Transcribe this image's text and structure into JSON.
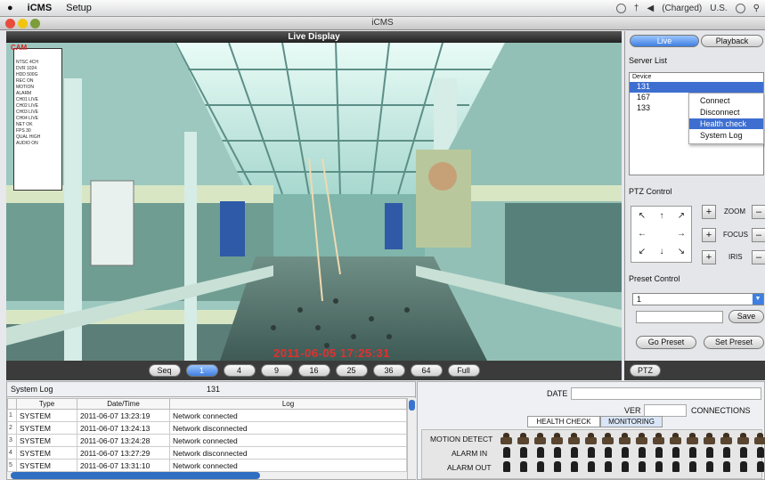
{
  "menubar": {
    "apple": "",
    "app": "iCMS",
    "setup": "Setup",
    "battery": "(Charged)",
    "lang": "U.S."
  },
  "window": {
    "title": "iCMS"
  },
  "video": {
    "header": "Live Display",
    "timestamp": "2011-06-05 17:25:31",
    "osd_logo": "CAM"
  },
  "modes": [
    "Seq",
    "1",
    "4",
    "9",
    "16",
    "25",
    "36",
    "64",
    "Full"
  ],
  "active_mode": "1",
  "right": {
    "tab_live": "Live",
    "tab_playback": "Playback",
    "server_list": "Server List",
    "col_device": "Device",
    "servers": [
      "131",
      "167",
      "133"
    ],
    "context_menu": [
      "Connect",
      "Disconnect",
      "Health check",
      "System Log"
    ],
    "selected_menu": "Health check",
    "ptz_control": "PTZ Control",
    "zoom": "ZOOM",
    "focus": "FOCUS",
    "iris": "IRIS",
    "preset_control": "Preset Control",
    "preset_value": "1",
    "save": "Save",
    "go_preset": "Go Preset",
    "set_preset": "Set Preset",
    "ptz_button": "PTZ"
  },
  "syslog": {
    "title": "System Log",
    "count": "131",
    "columns": [
      "Type",
      "Date/Time",
      "Log"
    ],
    "rows": [
      {
        "n": "1",
        "type": "SYSTEM",
        "time": "2011-06-07 13:23:19",
        "log": "Network connected"
      },
      {
        "n": "2",
        "type": "SYSTEM",
        "time": "2011-06-07 13:24:13",
        "log": "Network disconnected"
      },
      {
        "n": "3",
        "type": "SYSTEM",
        "time": "2011-06-07 13:24:28",
        "log": "Network connected"
      },
      {
        "n": "4",
        "type": "SYSTEM",
        "time": "2011-06-07 13:27:29",
        "log": "Network disconnected"
      },
      {
        "n": "5",
        "type": "SYSTEM",
        "time": "2011-06-07 13:31:10",
        "log": "Network connected"
      }
    ]
  },
  "status": {
    "date": "DATE",
    "ver": "VER",
    "connections": "CONNECTIONS",
    "health_check": "HEALTH CHECK",
    "monitoring": "MONITORING",
    "motion_detect": "MOTION DETECT",
    "alarm_in": "ALARM IN",
    "alarm_out": "ALARM OUT"
  }
}
